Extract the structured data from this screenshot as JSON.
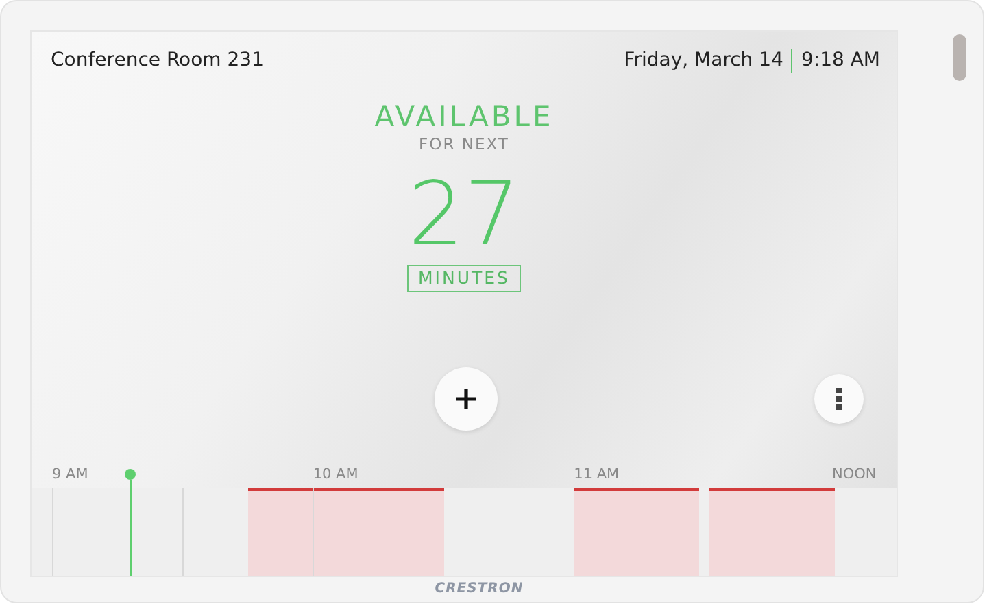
{
  "header": {
    "room": "Conference Room 231",
    "date": "Friday, March 14",
    "time": "9:18 AM"
  },
  "status": {
    "state": "AVAILABLE",
    "subtitle": "FOR NEXT",
    "count": "27",
    "unit": "MINUTES"
  },
  "actions": [
    {
      "kind": "add"
    },
    {
      "kind": "more"
    }
  ],
  "timeline": {
    "hours": [
      "9 AM",
      "10 AM",
      "11 AM",
      "NOON"
    ],
    "slots": [
      {
        "kind": "free"
      },
      {
        "kind": "busy"
      },
      {
        "kind": "free"
      },
      {
        "kind": "busy"
      },
      {
        "kind": "free"
      },
      {
        "kind": "busy"
      }
    ]
  },
  "brand": "CRESTRON"
}
